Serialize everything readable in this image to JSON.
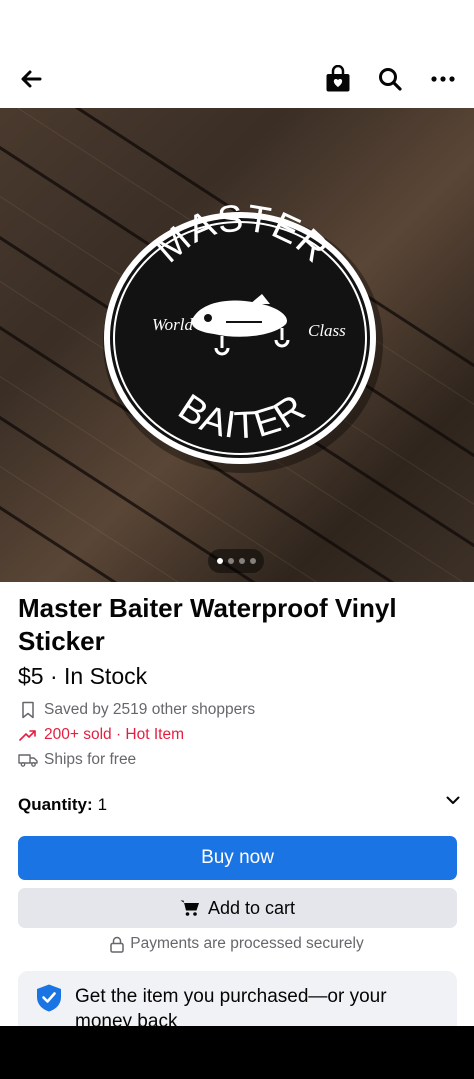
{
  "header": {
    "back_icon": "arrow-left-icon",
    "bag_icon": "shopping-bag-heart-icon",
    "search_icon": "search-icon",
    "more_icon": "more-horizontal-icon"
  },
  "product_image": {
    "sticker_top_text": "MASTER",
    "sticker_bottom_text": "BAITER",
    "sticker_left_text": "World",
    "sticker_right_text": "Class",
    "image_count": 4,
    "active_index": 1
  },
  "product": {
    "title": "Master Baiter Waterproof Vinyl Sticker",
    "price_stock": "$5 · In Stock",
    "saved_text": "Saved by 2519 other shoppers",
    "sold_text": "200+ sold · Hot Item",
    "shipping_text": "Ships for free"
  },
  "quantity": {
    "label": "Quantity:",
    "value": "1"
  },
  "actions": {
    "buy_now": "Buy now",
    "add_to_cart": "Add to cart",
    "secure_text": "Payments are processed securely"
  },
  "guarantee": {
    "text": "Get the item you purchased—or your money back"
  },
  "colors": {
    "primary_blue": "#1b74e4",
    "hot_red": "#e41e3f",
    "secondary_gray": "#e4e6eb",
    "text_muted": "#65676b"
  }
}
